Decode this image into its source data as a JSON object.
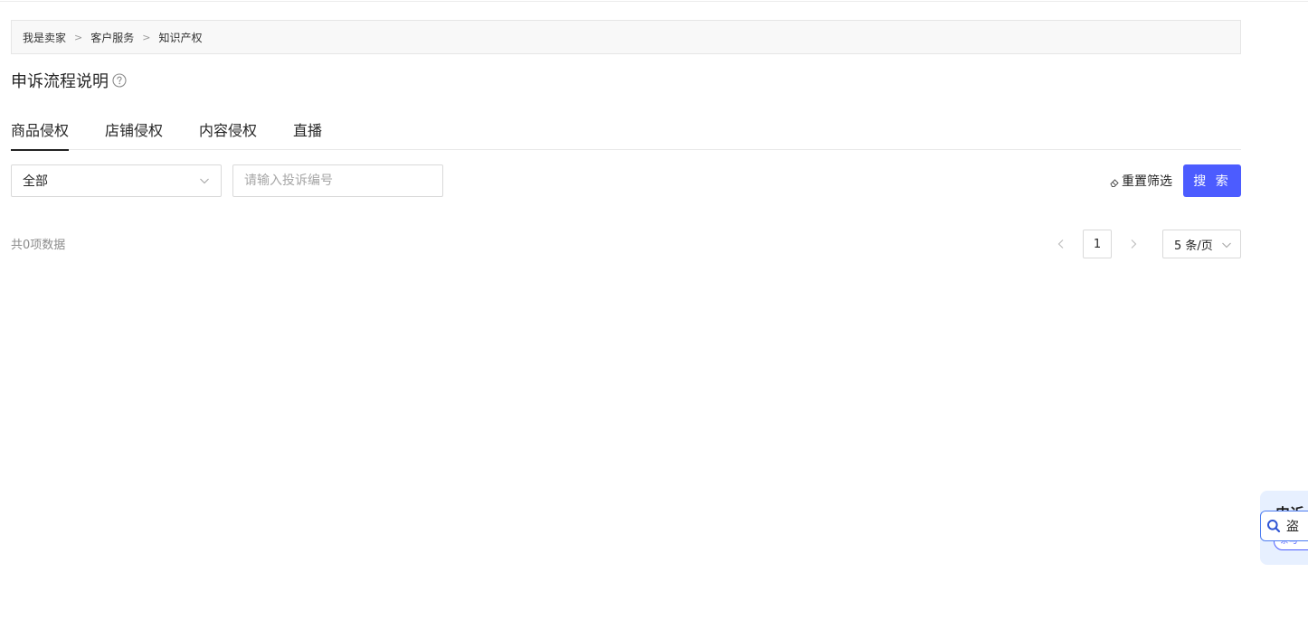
{
  "breadcrumb": {
    "items": [
      "我是卖家",
      "客户服务",
      "知识产权"
    ],
    "separator": ">"
  },
  "page": {
    "title": "申诉流程说明"
  },
  "tabs": [
    {
      "label": "商品侵权",
      "active": true
    },
    {
      "label": "店铺侵权",
      "active": false
    },
    {
      "label": "内容侵权",
      "active": false
    },
    {
      "label": "直播",
      "active": false
    }
  ],
  "filters": {
    "select_value": "全部",
    "search_placeholder": "请输入投诉编号",
    "search_value": "",
    "reset_label": "重置筛选",
    "search_button": "搜 索"
  },
  "results": {
    "total_text": "共0项数据"
  },
  "pagination": {
    "current_page": "1",
    "page_size": "5 条/页"
  },
  "floating_widget": {
    "title": "申诉",
    "tag": "条与",
    "search_label": "盗"
  },
  "colors": {
    "primary": "#4c5cff",
    "breadcrumb_bg": "#f8f8f8",
    "float_panel_bg": "#e7f0ff"
  }
}
